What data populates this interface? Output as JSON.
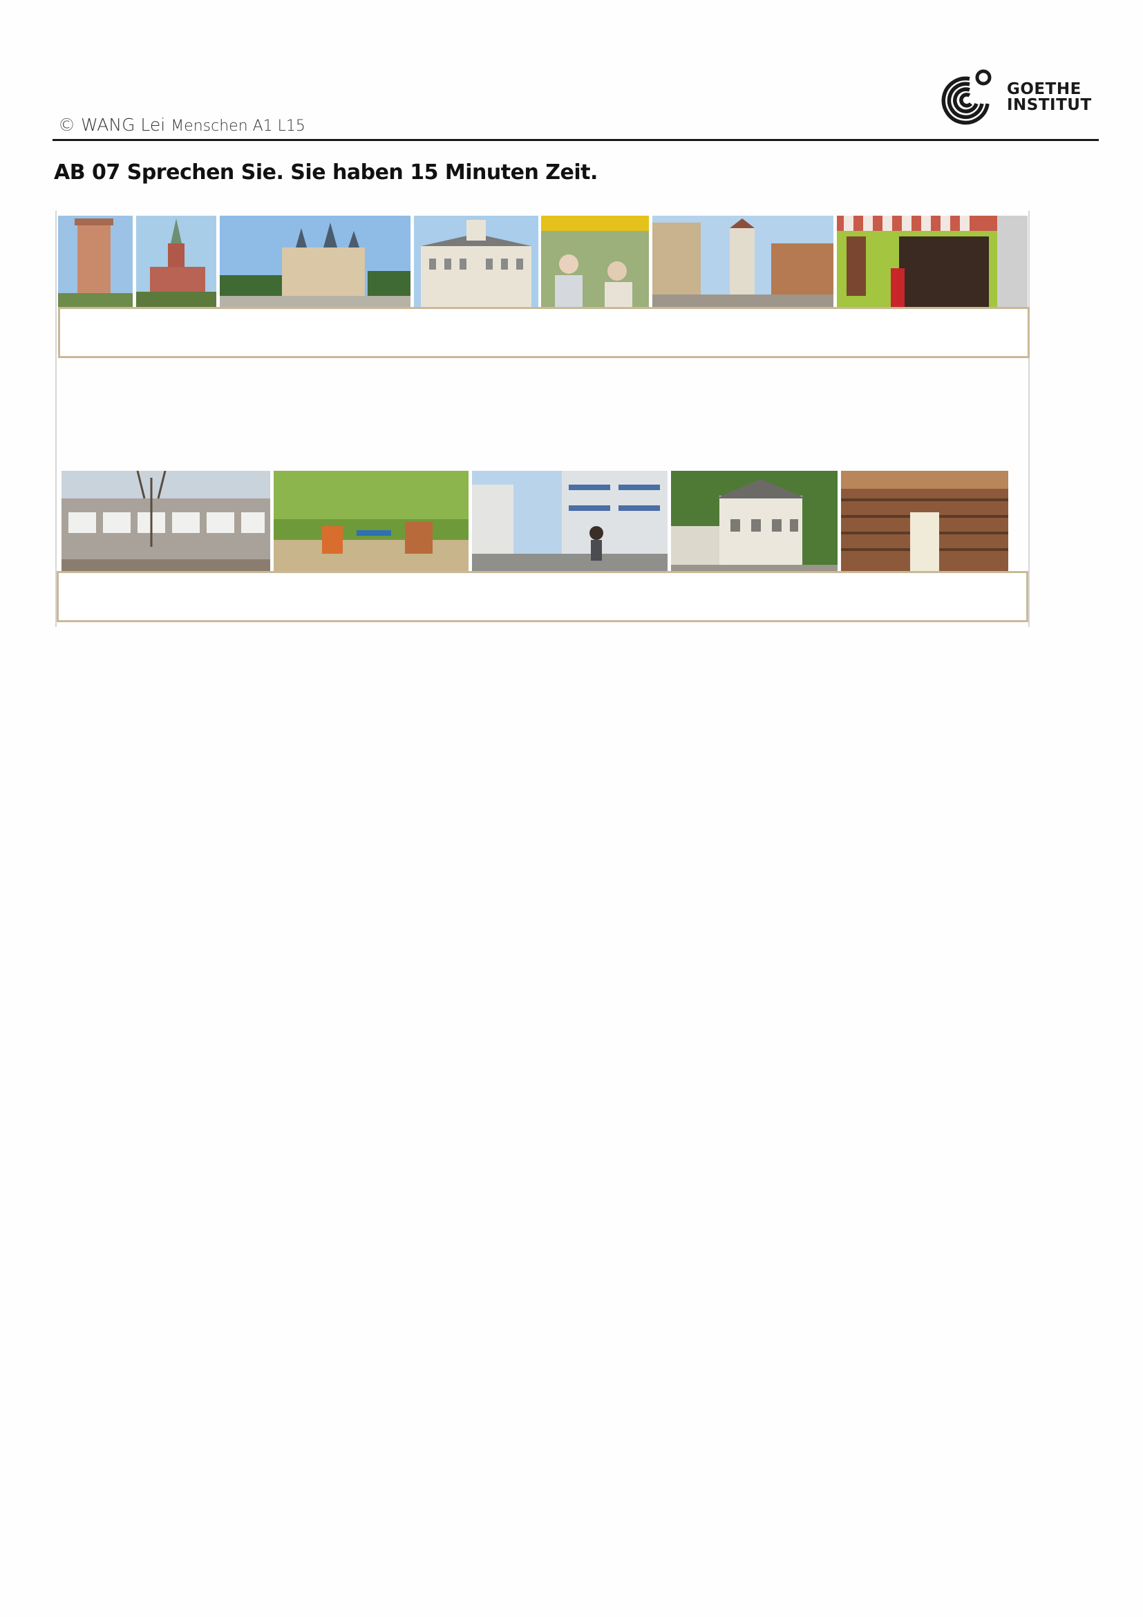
{
  "header": {
    "copyright": "© WANG Lei",
    "course": "Menschen A1 L15",
    "logo": {
      "line1": "GOETHE",
      "line2": "INSTITUT"
    }
  },
  "task": {
    "title": "AB 07 Sprechen Sie. Sie haben 15  Minuten Zeit."
  },
  "photos_top": [
    {
      "name": "tower-photo"
    },
    {
      "name": "church-photo"
    },
    {
      "name": "castle-photo"
    },
    {
      "name": "town-hall-photo"
    },
    {
      "name": "market-photo"
    },
    {
      "name": "old-town-gate-photo"
    },
    {
      "name": "shop-photo"
    }
  ],
  "photos_bottom": [
    {
      "name": "school-building-photo"
    },
    {
      "name": "playground-photo"
    },
    {
      "name": "modern-building-photo"
    },
    {
      "name": "youth-hostel-photo"
    },
    {
      "name": "library-photo"
    }
  ],
  "colors": {
    "answer_box_border": "#c9b998",
    "rule": "#1a1a1a"
  }
}
